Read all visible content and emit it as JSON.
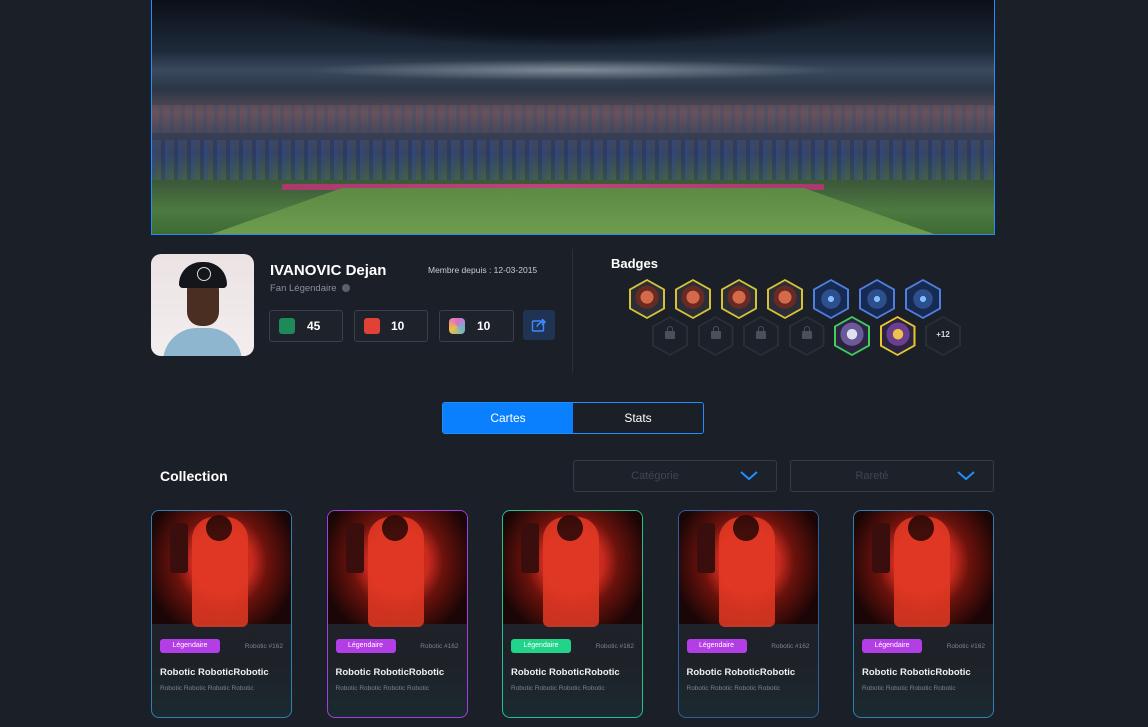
{
  "profile": {
    "name": "IVANOVIC Dejan",
    "member_since": "Membre depuis : 12-03-2015",
    "level": "Fan Légendaire",
    "stats": [
      {
        "icon": "stadium-icon",
        "value": "45",
        "color": "#1e8a5a"
      },
      {
        "icon": "cards-icon",
        "value": "10",
        "color": "#e24235"
      },
      {
        "icon": "gem-icon",
        "value": "10",
        "color": "#6fb4c8"
      }
    ]
  },
  "badges": {
    "title": "Badges",
    "row1": [
      "gold",
      "gold",
      "gold",
      "gold",
      "blue",
      "blue",
      "blue"
    ],
    "row2": [
      "lock",
      "lock",
      "lock",
      "lock",
      "green",
      "gold2",
      "more"
    ],
    "more_label": "+12"
  },
  "tabs": [
    {
      "label": "Cartes",
      "active": true
    },
    {
      "label": "Stats",
      "active": false
    }
  ],
  "collection": {
    "title": "Collection",
    "filters": [
      {
        "placeholder": "Catégorie"
      },
      {
        "placeholder": "Rareté"
      }
    ],
    "cards": [
      {
        "rarity": "Légendaire",
        "rarity_color": "#b33ee6",
        "number": "Robotic #162",
        "title": "Robotic RoboticRobotic",
        "subtitle": "Robotic Robotic Robotic Robotic",
        "border": "#2f7fb0"
      },
      {
        "rarity": "Légendaire",
        "rarity_color": "#b33ee6",
        "number": "Robotic #162",
        "title": "Robotic RoboticRobotic",
        "subtitle": "Robotic Robotic Robotic Robotic",
        "border": "#a03ee0"
      },
      {
        "rarity": "Légendaire",
        "rarity_color": "#22d48a",
        "number": "Robotic #162",
        "title": "Robotic RoboticRobotic",
        "subtitle": "Robotic Robotic Robotic Robotic",
        "border": "#22c48a"
      },
      {
        "rarity": "Légendaire",
        "rarity_color": "#b33ee6",
        "number": "Robotic #162",
        "title": "Robotic RoboticRobotic",
        "subtitle": "Robotic Robotic Robotic Robotic",
        "border": "#2f5f9a"
      },
      {
        "rarity": "Légendaire",
        "rarity_color": "#b33ee6",
        "number": "Robotic #162",
        "title": "Robotic RoboticRobotic",
        "subtitle": "Robotic Robotic Robotic Robotic",
        "border": "#2f7fb0"
      }
    ]
  },
  "colors": {
    "accent": "#0b80ff",
    "background": "#1b1f27"
  }
}
